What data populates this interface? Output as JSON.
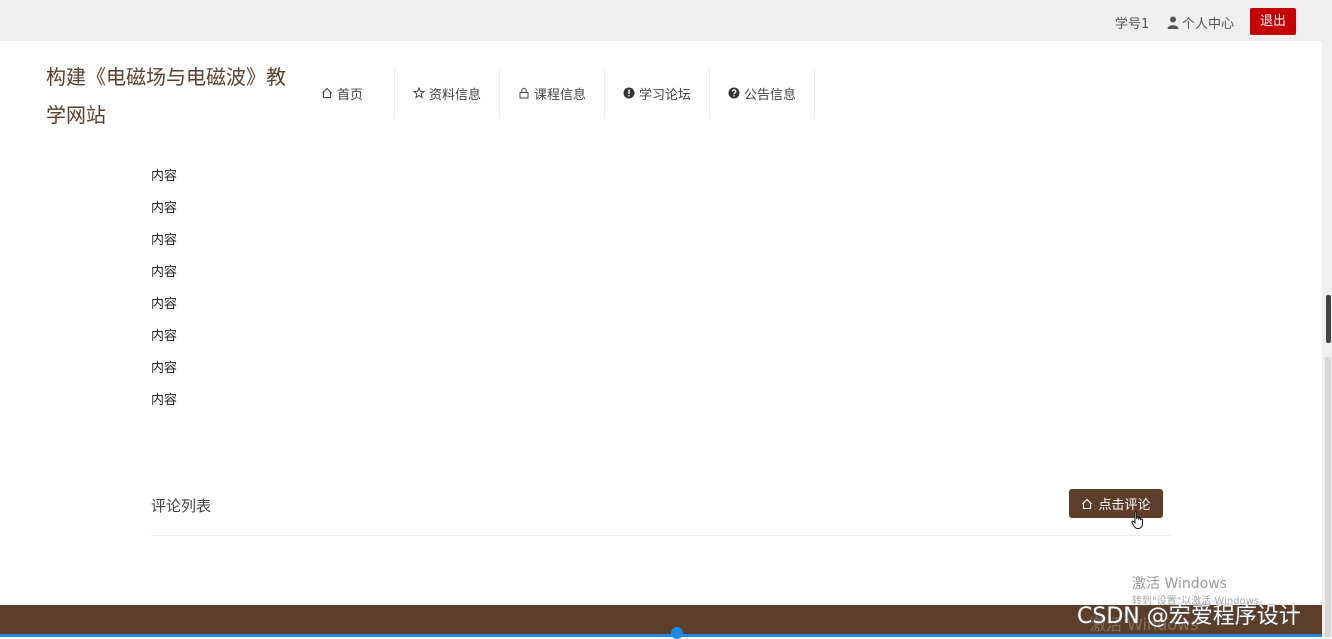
{
  "header": {
    "student": "学号1",
    "user_center": "个人中心",
    "logout": "退出"
  },
  "brand": {
    "title": "构建《电磁场与电磁波》教学网站"
  },
  "nav": {
    "items": [
      {
        "label": "首页",
        "icon": "home-icon"
      },
      {
        "label": "资料信息",
        "icon": "star-icon"
      },
      {
        "label": "课程信息",
        "icon": "lock-icon"
      },
      {
        "label": "学习论坛",
        "icon": "exclamation-circle-icon"
      },
      {
        "label": "公告信息",
        "icon": "question-circle-icon"
      }
    ]
  },
  "content": {
    "lines": [
      "内容",
      "内容",
      "内容",
      "内容",
      "内容",
      "内容",
      "内容",
      "内容"
    ]
  },
  "comments": {
    "title": "评论列表",
    "button": "点击评论"
  },
  "watermark": {
    "line1": "激活 Windows",
    "line2": "转到\"设置\"以激活 Windows。",
    "line3": "激活 Windows"
  },
  "overlay": {
    "csdn": "CSDN @宏爱程序设计"
  },
  "colors": {
    "brand_brown": "#5c3e2b",
    "logout_red": "#c40000",
    "topbar_bg": "#efefef"
  }
}
